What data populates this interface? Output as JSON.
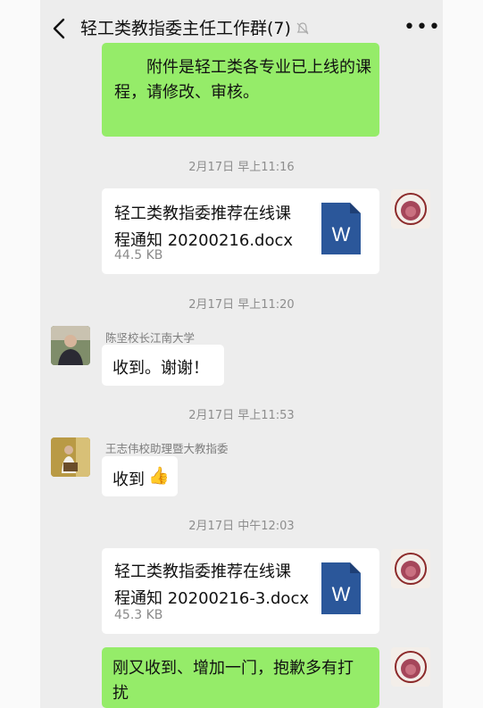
{
  "header": {
    "title": "轻工类教指委主任工作群(7)",
    "more": "•••"
  },
  "messages": {
    "m1": {
      "line1": "附件是轻工类各专业已上线的课",
      "line2": "程，请修改、审核。"
    },
    "t1": "2月17日 早上11:16",
    "f1": {
      "line1": "轻工类教指委推荐在线课",
      "line2": "程通知 20200216.docx",
      "size": "44.5 KB",
      "icon": "W"
    },
    "t2": "2月17日 早上11:20",
    "m2": {
      "sender": "陈坚校长江南大学",
      "text": "收到。谢谢！"
    },
    "t3": "2月17日 早上11:53",
    "m3": {
      "sender": "王志伟校助理暨大教指委",
      "text": "收到",
      "emoji": "👍"
    },
    "t4": "2月17日 中午12:03",
    "f2": {
      "line1": "轻工类教指委推荐在线课",
      "line2": "程通知 20200216-3.docx",
      "size": "45.3 KB",
      "icon": "W"
    },
    "m4": {
      "line1": "刚又收到、增加一门，抱歉多有打",
      "line2": "扰"
    }
  },
  "colors": {
    "green_bubble": "#95ec69",
    "word_blue": "#2b579a",
    "background": "#ededed"
  }
}
